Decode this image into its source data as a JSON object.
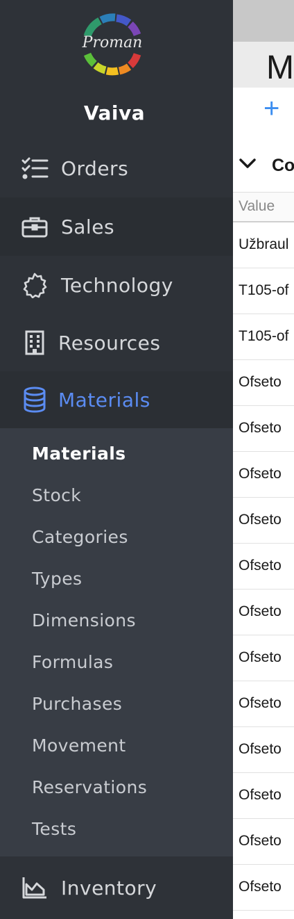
{
  "brand": {
    "logo_text": "Proman"
  },
  "sidebar": {
    "user": "Vaiva",
    "nav": [
      {
        "label": "Orders",
        "icon": "checklist-icon"
      },
      {
        "label": "Sales",
        "icon": "briefcase-icon"
      },
      {
        "label": "Technology",
        "icon": "gear-outline-icon"
      },
      {
        "label": "Resources",
        "icon": "building-icon"
      },
      {
        "label": "Materials",
        "icon": "database-icon"
      },
      {
        "label": "Inventory",
        "icon": "area-chart-icon"
      }
    ],
    "submenu": [
      "Materials",
      "Stock",
      "Categories",
      "Types",
      "Dimensions",
      "Formulas",
      "Purchases",
      "Movement",
      "Reservations",
      "Tests"
    ],
    "active_color": "#5b8cf2"
  },
  "main": {
    "title": "M",
    "add_label": "+",
    "section_label": "Co",
    "column_header": "Value",
    "rows": [
      "Užbraul",
      "T105-of",
      "T105-of",
      "Ofseto",
      "Ofseto",
      "Ofseto",
      "Ofseto",
      "Ofseto",
      "Ofseto",
      "Ofseto",
      "Ofseto",
      "Ofseto",
      "Ofseto",
      "Ofseto",
      "Ofseto"
    ]
  }
}
